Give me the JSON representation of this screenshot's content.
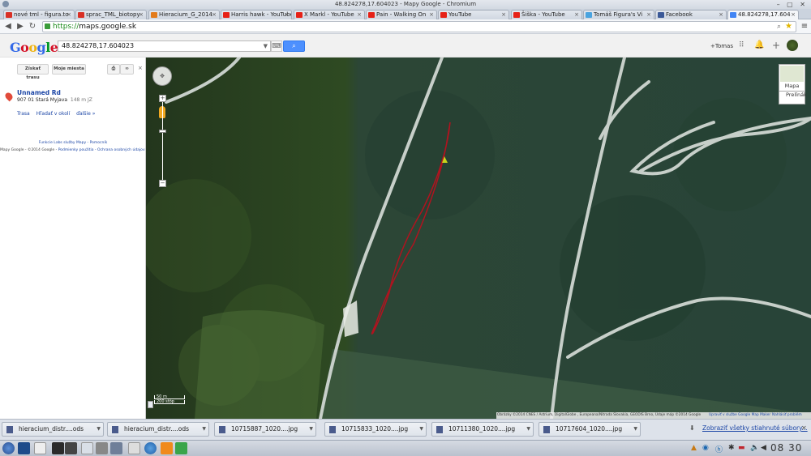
{
  "window": {
    "title": "48.824278,17.604023 - Mapy Google - Chromium"
  },
  "tabs": [
    {
      "label": "nové tml - figura.to",
      "color": "#d93025"
    },
    {
      "label": "sprac_TML_biotopy",
      "color": "#d93025"
    },
    {
      "label": "Hieracium_G_2014",
      "color": "#e37b1b"
    },
    {
      "label": "Harris hawk - YouTube",
      "color": "#e62117"
    },
    {
      "label": "X Markl - YouTube",
      "color": "#e62117"
    },
    {
      "label": "Pain - Walking On",
      "color": "#e62117"
    },
    {
      "label": "YouTube",
      "color": "#e62117"
    },
    {
      "label": "Šiška - YouTube",
      "color": "#e62117"
    },
    {
      "label": "Tomáš Figura's Vi",
      "color": "#4aa3df"
    },
    {
      "label": "Facebook",
      "color": "#3b5998"
    },
    {
      "label": "48.824278,17.604",
      "color": "#4285f4"
    }
  ],
  "address_bar": {
    "scheme": "https://",
    "host": "maps.google.sk"
  },
  "google": {
    "logo": [
      "G",
      "o",
      "o",
      "g",
      "l",
      "e"
    ],
    "search_value": "48.824278,17.604023",
    "user": "+Tomas"
  },
  "left_panel": {
    "btn_route": "Získať trasu",
    "btn_places": "Moje miesta",
    "result_name": "Unnamed Rd",
    "result_address": "907 01 Stará Myjava",
    "result_distance": "148 m JZ",
    "links": [
      "Trasa",
      "Hľadať v okolí",
      "ďalšie »"
    ],
    "footer_links": "Funkcie Labs služby Mapy - Pomocník",
    "footer_copy": "Mapy Google - ©2014 Google -",
    "footer_terms": "Podmienky použitia - Ochrana osobných údajov"
  },
  "map": {
    "type_label": "Mapa",
    "satellite_label": "Prelínák",
    "scale_top": "50 m",
    "scale_bottom": "200 stôp",
    "attribution": "Obrázky ©2014 CNES / Astrium, DigitalGlobe , Europeana/Nitrada Slovakia, GEODIS Brno, Údaje máp ©2014 Google",
    "edit_link": "Upraviť v službe Google Map Maker",
    "report_link": "Nahlásiť problém",
    "colors": {
      "track": "#b0131f",
      "marker": "#e14b3b",
      "forest": "#2c4a34",
      "road": "#c7cfc9"
    }
  },
  "downloads": {
    "items": [
      "hieracium_distr....ods",
      "hieracium_distr....ods",
      "10715887_1020....jpg",
      "10715833_1020....jpg",
      "10711380_1020....jpg",
      "10717604_1020....jpg"
    ],
    "show_all": "Zobraziť všetky stiahnuté súbory..."
  },
  "taskbar": {
    "clock": "08 30"
  }
}
